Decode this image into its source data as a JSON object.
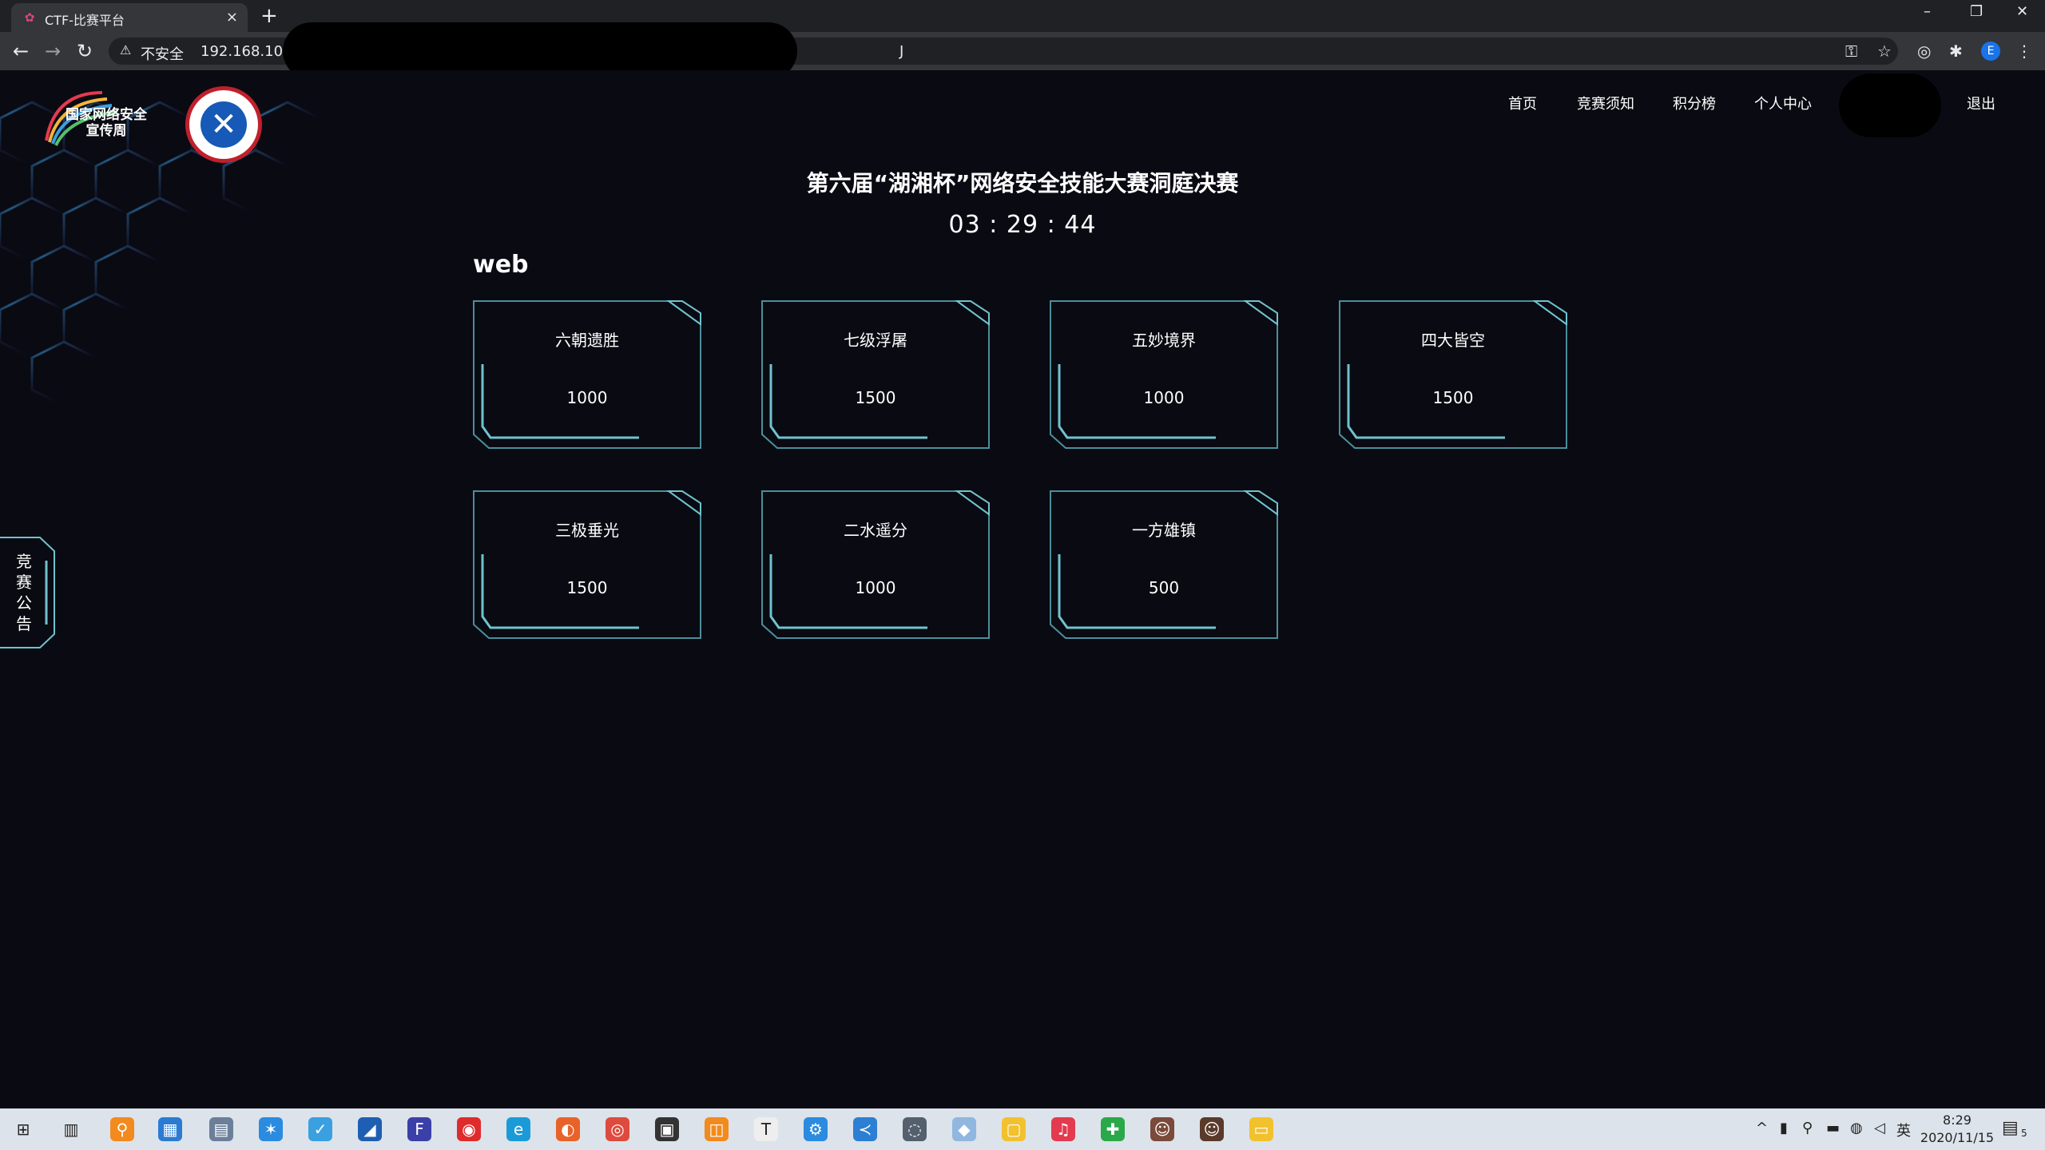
{
  "browser": {
    "tab_title": "CTF-比赛平台",
    "address_insecure": "不安全",
    "address_url_visible": "192.168.100.",
    "address_url_tail": "J"
  },
  "site": {
    "logo_text_line1": "国家网络安全",
    "logo_text_line2": "宣传周",
    "nav": [
      "首页",
      "竞赛须知",
      "积分榜",
      "个人中心",
      "退出"
    ],
    "title": "第六届“湖湘杯”网络安全技能大赛洞庭决赛",
    "timer": "03 : 29 : 44",
    "category": "web",
    "challenges": [
      {
        "name": "六朝遗胜",
        "score": "1000"
      },
      {
        "name": "七级浮屠",
        "score": "1500"
      },
      {
        "name": "五妙境界",
        "score": "1000"
      },
      {
        "name": "四大皆空",
        "score": "1500"
      },
      {
        "name": "三极垂光",
        "score": "1500"
      },
      {
        "name": "二水遥分",
        "score": "1000"
      },
      {
        "name": "一方雄镇",
        "score": "500"
      }
    ],
    "notice_tab": "竞赛公告"
  },
  "taskbar": {
    "ime": "英",
    "time": "8:29",
    "date": "2020/11/15",
    "notification_count": "5"
  },
  "colors": {
    "page_bg": "#0a0a12",
    "card_border": "#4a8f9b",
    "card_accent": "#6fc3cf"
  }
}
